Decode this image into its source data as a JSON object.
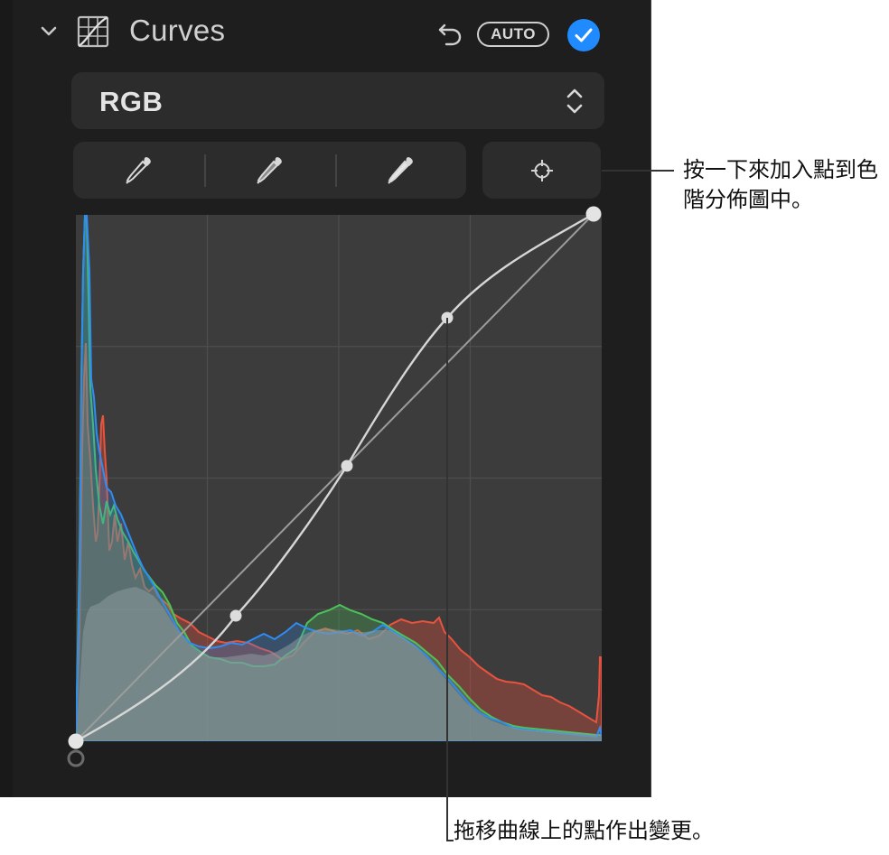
{
  "header": {
    "title": "Curves",
    "auto_label": "AUTO"
  },
  "channel": {
    "selected": "RGB"
  },
  "icons": {
    "collapse": "chevron-down-icon",
    "curves": "curves-grid-icon",
    "undo": "undo-icon",
    "enabled": "checkmark-icon",
    "select": "chevron-up-down-icon",
    "black_point": "eyedropper-icon",
    "gray_point": "eyedropper-icon",
    "white_point": "eyedropper-icon",
    "add_point": "crosshair-icon"
  },
  "colors": {
    "panel": "#1e1e1e",
    "control": "#2c2c2c",
    "accent": "#1f8bff",
    "red_channel": "#e8533f",
    "green_channel": "#4cc35a",
    "blue_channel": "#2f8cf0"
  },
  "curve_points": [
    {
      "input": 0,
      "output": 0
    },
    {
      "input": 0.3,
      "output": 0.24
    },
    {
      "input": 0.52,
      "output": 0.53
    },
    {
      "input": 0.7,
      "output": 0.81
    },
    {
      "input": 1,
      "output": 1
    }
  ],
  "annotations": {
    "add_point": "按一下來加入點到色階分佈圖中。",
    "drag_point": "拖移曲線上的點作出變更。"
  }
}
